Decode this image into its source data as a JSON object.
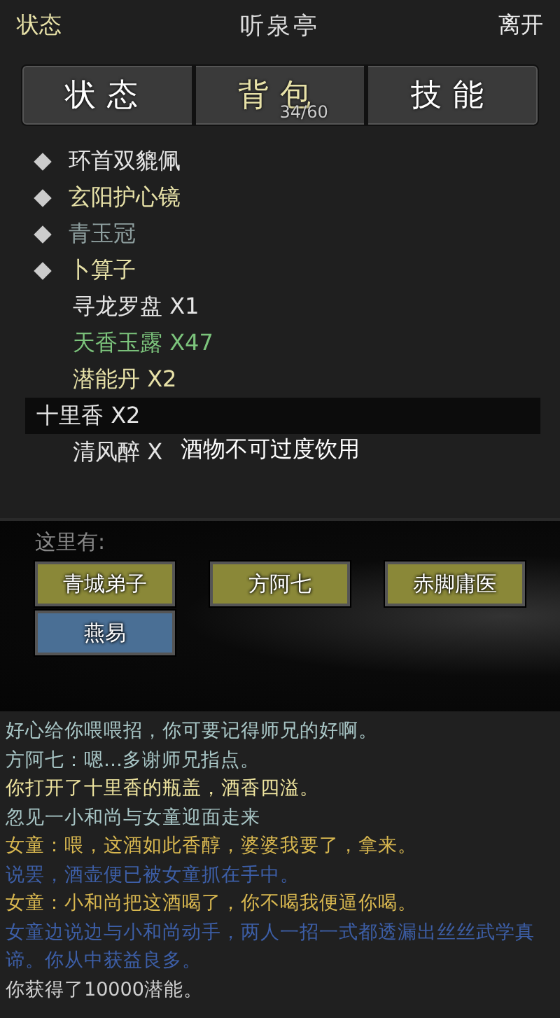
{
  "header": {
    "left": "状态",
    "title": "听泉亭",
    "right": "离开"
  },
  "tabs": [
    {
      "label": "状态",
      "selected": false
    },
    {
      "label": "背包",
      "selected": true,
      "badge": "34/60"
    },
    {
      "label": "技能",
      "selected": false
    }
  ],
  "items": [
    {
      "kind": "equipment",
      "name": "环首双貔佩",
      "color": "#e6e6e6",
      "selected": false
    },
    {
      "kind": "equipment",
      "name": "玄阳护心镜",
      "color": "#e8e2a8",
      "selected": false
    },
    {
      "kind": "equipment",
      "name": "青玉冠",
      "color": "#8fa0a0",
      "selected": false
    },
    {
      "kind": "equipment",
      "name": "卜算子",
      "color": "#e8e2a8",
      "selected": false
    },
    {
      "kind": "consumable",
      "name": "寻龙罗盘 X1",
      "color": "#e6e6e6",
      "selected": false
    },
    {
      "kind": "consumable",
      "name": "天香玉露 X47",
      "color": "#7cc47c",
      "selected": false
    },
    {
      "kind": "consumable",
      "name": "潜能丹 X2",
      "color": "#e8e2a8",
      "selected": false
    },
    {
      "kind": "consumable",
      "name": "十里香 X2",
      "color": "#e6e6e6",
      "selected": true
    },
    {
      "kind": "consumable",
      "name": "清风醉 X",
      "color": "#e6e6e6",
      "selected": false
    }
  ],
  "tooltip": "酒物不可过度饮用",
  "here": {
    "label": "这里有:",
    "npcs": [
      {
        "name": "青城弟子",
        "color": "#8a8838"
      },
      {
        "name": "方阿七",
        "color": "#8a8838"
      },
      {
        "name": "赤脚庸医",
        "color": "#8a8838"
      },
      {
        "name": "燕易",
        "color": "#4a6f95"
      }
    ]
  },
  "log": [
    {
      "text": "好心给你喂喂招，你可要记得师兄的好啊。",
      "color": "#a9c7c7"
    },
    {
      "text": "方阿七：嗯…多谢师兄指点。",
      "color": "#a9c7c7"
    },
    {
      "text": "你打开了十里香的瓶盖，酒香四溢。",
      "color": "#f0e6a0"
    },
    {
      "text": "忽见一小和尚与女童迎面走来",
      "color": "#a9c7c7"
    },
    {
      "text": "女童：喂，这酒如此香醇，婆婆我要了，拿来。",
      "color": "#d9b850"
    },
    {
      "text": "说罢，酒壶便已被女童抓在手中。",
      "color": "#3d5fa8"
    },
    {
      "text": "女童：小和尚把这酒喝了，你不喝我便逼你喝。",
      "color": "#d9b850"
    },
    {
      "text": "女童边说边与小和尚动手，两人一招一式都透漏出丝丝武学真谛。你从中获益良多。",
      "color": "#3d5fa8"
    },
    {
      "text": "你获得了10000潜能。",
      "color": "#d0d0d0"
    }
  ]
}
